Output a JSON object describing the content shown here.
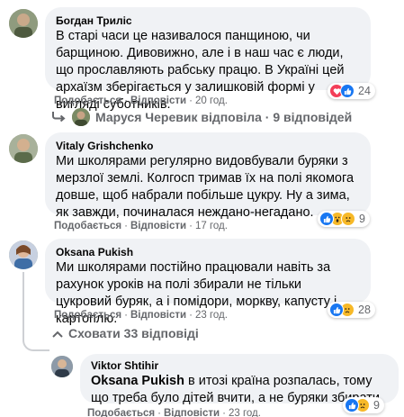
{
  "colors": {
    "bubble_bg": "#f0f2f5",
    "secondary_text": "#65676b",
    "like_blue": "#1877f2",
    "love_red": "#f33e58",
    "emoji_yellow": "#f7b928"
  },
  "action_labels": {
    "like": "Подобається",
    "reply": "Відповісти",
    "dot": "·"
  },
  "comments": [
    {
      "author": "Богдан Триліс",
      "text": "В старі часи це називалося панщиною, чи барщиною. Дивовижно, але і в наш час є люди, що прославляють рабську працю. В Україні цей архаїзм зберігається у залишковій формі у вигляді суботників.",
      "time": "20 год.",
      "reactions": {
        "icons": [
          "love-icon",
          "like-icon"
        ],
        "count": "24"
      }
    },
    {
      "author": "Vitaly Grishchenko",
      "text": "Ми школярами регулярно видовбували буряки з мерзлої землі. Колгосп тримав їх на полі якомога довше, щоб набрали побільше цукру. Ну а зима, як завжди, починалася нежданo-негадано.",
      "time": "17 год.",
      "reactions": {
        "icons": [
          "like-icon",
          "wow-icon",
          "sad-icon"
        ],
        "count": "9"
      }
    },
    {
      "author": "Oksana Pukish",
      "text": "Ми школярами постійно працювали навіть за рахунок уроків на полі збирали не тільки цукровий буряк, а і помідори, моркву, капусту і картоплю.",
      "time": "23 год.",
      "reactions": {
        "icons": [
          "like-icon",
          "sad-icon"
        ],
        "count": "28"
      }
    }
  ],
  "reply_summary": {
    "text": "Маруся Черевик відповіла · 9 відповідей",
    "icon": "reply-arrow-icon"
  },
  "hide_replies": {
    "text": "Сховати 33 відповіді",
    "icon": "chevron-up-icon"
  },
  "reply": {
    "author": "Viktor Shtihir",
    "mention": "Oksana Pukish",
    "text": " в итозі країна розпалась, тому що треба було дітей вчити, а не буряки збирати.",
    "time": "23 год.",
    "reactions": {
      "icons": [
        "like-icon",
        "sad-icon"
      ],
      "count": "9"
    }
  }
}
